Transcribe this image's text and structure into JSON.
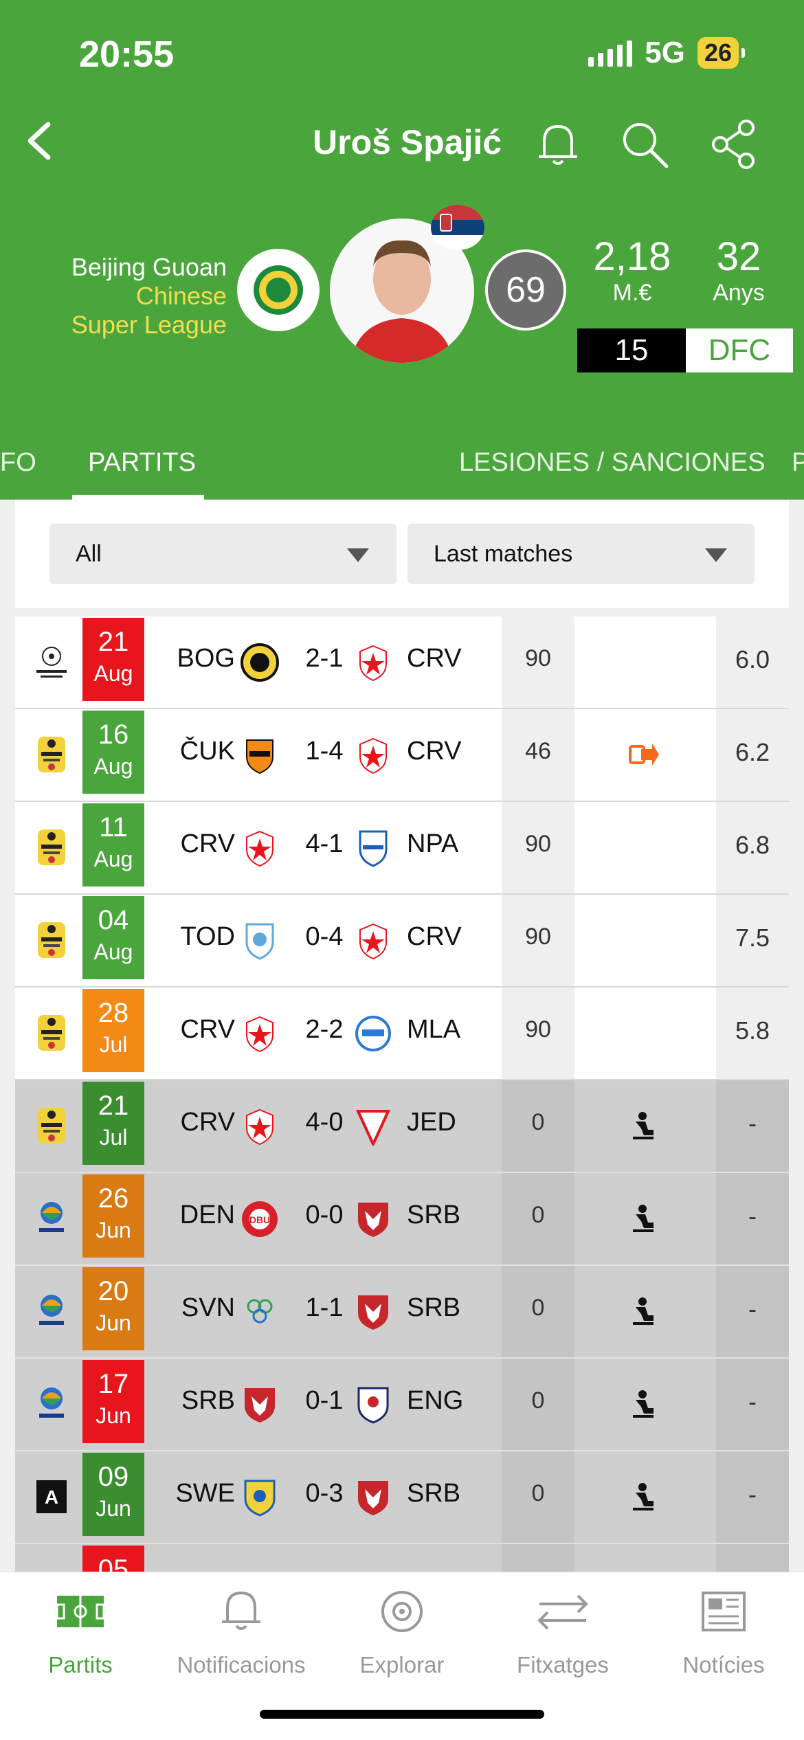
{
  "status_bar": {
    "time": "20:55",
    "network": "5G",
    "battery": "26"
  },
  "header": {
    "title": "Uroš Spajić"
  },
  "player": {
    "club": "Beijing Guoan",
    "league": "Chinese Super League",
    "rating": "69",
    "value": "2,18",
    "value_unit": "M.€",
    "age": "32",
    "age_unit": "Anys",
    "shirt_number": "15",
    "position": "DFC"
  },
  "tabs": [
    "FO",
    "PARTITS",
    "LESIONES / SANCIONES",
    "P"
  ],
  "active_tab": "PARTITS",
  "filters": {
    "competition": "All",
    "range": "Last matches"
  },
  "colors": {
    "green": "#4aa53c",
    "win": "#4aa53c",
    "loss": "#e8161c",
    "draw": "#f28a13",
    "draw_past": "#d97a12",
    "win_past": "#3b8e30"
  },
  "matches": [
    {
      "comp": "champions-league",
      "day": "21",
      "month": "Aug",
      "result": "loss",
      "home": "BOG",
      "score": "2-1",
      "away": "CRV",
      "mins": "90",
      "event": "",
      "rating": "6.0",
      "played": true
    },
    {
      "comp": "mozzart-superliga",
      "day": "16",
      "month": "Aug",
      "result": "win",
      "home": "ČUK",
      "score": "1-4",
      "away": "CRV",
      "mins": "46",
      "event": "sub-out",
      "rating": "6.2",
      "played": true
    },
    {
      "comp": "mozzart-superliga",
      "day": "11",
      "month": "Aug",
      "result": "win",
      "home": "CRV",
      "score": "4-1",
      "away": "NPA",
      "mins": "90",
      "event": "",
      "rating": "6.8",
      "played": true
    },
    {
      "comp": "mozzart-superliga",
      "day": "04",
      "month": "Aug",
      "result": "win",
      "home": "TOD",
      "score": "0-4",
      "away": "CRV",
      "mins": "90",
      "event": "",
      "rating": "7.5",
      "played": true
    },
    {
      "comp": "mozzart-superliga",
      "day": "28",
      "month": "Jul",
      "result": "draw",
      "home": "CRV",
      "score": "2-2",
      "away": "MLA",
      "mins": "90",
      "event": "",
      "rating": "5.8",
      "played": true
    },
    {
      "comp": "mozzart-superliga",
      "day": "21",
      "month": "Jul",
      "result": "win",
      "home": "CRV",
      "score": "4-0",
      "away": "JED",
      "mins": "0",
      "event": "bench",
      "rating": "-",
      "played": false
    },
    {
      "comp": "euro-2024",
      "day": "26",
      "month": "Jun",
      "result": "draw",
      "home": "DEN",
      "score": "0-0",
      "away": "SRB",
      "mins": "0",
      "event": "bench",
      "rating": "-",
      "played": false
    },
    {
      "comp": "euro-2024",
      "day": "20",
      "month": "Jun",
      "result": "draw",
      "home": "SVN",
      "score": "1-1",
      "away": "SRB",
      "mins": "0",
      "event": "bench",
      "rating": "-",
      "played": false
    },
    {
      "comp": "euro-2024",
      "day": "17",
      "month": "Jun",
      "result": "loss",
      "home": "SRB",
      "score": "0-1",
      "away": "ENG",
      "mins": "0",
      "event": "bench",
      "rating": "-",
      "played": false
    },
    {
      "comp": "amistoso",
      "day": "09",
      "month": "Jun",
      "result": "win",
      "home": "SWE",
      "score": "0-3",
      "away": "SRB",
      "mins": "0",
      "event": "bench",
      "rating": "-",
      "played": false
    },
    {
      "comp": "unknown",
      "day": "05",
      "month": "",
      "result": "loss",
      "home": "",
      "score": "",
      "away": "",
      "mins": "",
      "event": "",
      "rating": "",
      "played": false
    }
  ],
  "bottom_nav": [
    {
      "label": "Partits",
      "icon": "pitch-icon",
      "active": true
    },
    {
      "label": "Notificacions",
      "icon": "bell-icon",
      "active": false
    },
    {
      "label": "Explorar",
      "icon": "explore-icon",
      "active": false
    },
    {
      "label": "Fitxatges",
      "icon": "transfer-icon",
      "active": false
    },
    {
      "label": "Notícies",
      "icon": "news-icon",
      "active": false
    }
  ]
}
